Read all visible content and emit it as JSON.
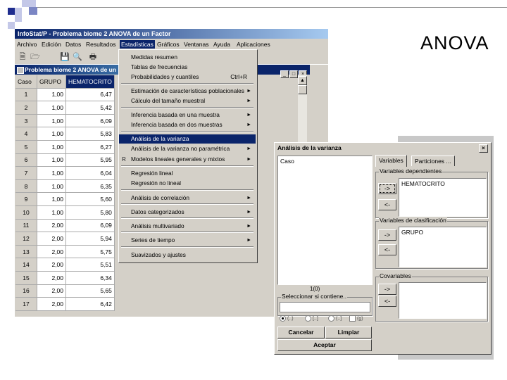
{
  "slide_title": "ANOVA",
  "app": {
    "title": "InfoStat/P - Problema biome 2 ANOVA de un Factor",
    "menus": [
      "Archivo",
      "Edición",
      "Datos",
      "Resultados",
      "Estadísticas",
      "Gráficos",
      "Ventanas",
      "Ayuda",
      "Aplicaciones"
    ]
  },
  "toolbar": {
    "icons": [
      "new-file-icon",
      "open-file-icon",
      "save-icon",
      "print-preview-icon",
      "print-icon"
    ]
  },
  "data_window": {
    "title": "Problema biome 2 ANOVA de un",
    "columns": [
      "Caso",
      "GRUPO",
      "HEMATOCRITO"
    ],
    "rows": [
      [
        "1",
        "1,00",
        "6,47"
      ],
      [
        "2",
        "1,00",
        "5,42"
      ],
      [
        "3",
        "1,00",
        "6,09"
      ],
      [
        "4",
        "1,00",
        "5,83"
      ],
      [
        "5",
        "1,00",
        "6,27"
      ],
      [
        "6",
        "1,00",
        "5,95"
      ],
      [
        "7",
        "1,00",
        "6,04"
      ],
      [
        "8",
        "1,00",
        "6,35"
      ],
      [
        "9",
        "1,00",
        "5,60"
      ],
      [
        "10",
        "1,00",
        "5,80"
      ],
      [
        "11",
        "2,00",
        "6,09"
      ],
      [
        "12",
        "2,00",
        "5,94"
      ],
      [
        "13",
        "2,00",
        "5,75"
      ],
      [
        "14",
        "2,00",
        "5,51"
      ],
      [
        "15",
        "2,00",
        "6,34"
      ],
      [
        "16",
        "2,00",
        "5,65"
      ],
      [
        "17",
        "2,00",
        "6,42"
      ]
    ]
  },
  "menu": {
    "items": [
      {
        "label": "Medidas resumen",
        "arrow": false
      },
      {
        "label": "Tablas de frecuencias",
        "arrow": false
      },
      {
        "label": "Probabilidades y cuantiles",
        "shortcut": "Ctrl+R"
      },
      {
        "label": "Estimación de características poblacionales",
        "arrow": true
      },
      {
        "label": "Cálculo del tamaño muestral",
        "arrow": true
      },
      {
        "label": "Inferencia basada en una muestra",
        "arrow": true
      },
      {
        "label": "Inferencia basada en dos muestras",
        "arrow": true
      },
      {
        "label": "Análisis de la varianza",
        "arrow": false,
        "highlighted": true
      },
      {
        "label": "Análisis de la varianza no paramétrica",
        "arrow": true
      },
      {
        "label": "Modelos lineales generales y mixtos",
        "arrow": true
      },
      {
        "label": "Regresión lineal",
        "arrow": false
      },
      {
        "label": "Regresión no lineal",
        "arrow": false
      },
      {
        "label": "Análisis de correlación",
        "arrow": true
      },
      {
        "label": "Datos categorizados",
        "arrow": true
      },
      {
        "label": "Análisis multivariado",
        "arrow": true
      },
      {
        "label": "Series de tiempo",
        "arrow": true
      },
      {
        "label": "Suavizados y ajustes",
        "arrow": false
      }
    ]
  },
  "dialog": {
    "title": "Análisis de la varianza",
    "source_list_item": "Caso",
    "count": "1(0)",
    "filter_label": "Seleccionar si contiene..",
    "radio_labels": [
      "(..)",
      "[..]",
      "(..]",
      "(g)"
    ],
    "tabs": [
      "Variables",
      "Particiones ..."
    ],
    "dependent_label": "Variables dependientes",
    "dependent_value": "HEMATOCRITO",
    "class_label": "Variables de clasificación",
    "class_value": "GRUPO",
    "covariables_label": "Covariables",
    "add_arrow": "->",
    "remove_arrow": "<-",
    "cancel_label": "Cancelar",
    "clear_label": "Limpiar",
    "accept_label": "Aceptar"
  },
  "colors": {
    "title_bar": "#0a246a",
    "menu_highlight": "#0a246a",
    "decor_blue": "#1f2d8f",
    "window_face": "#d4d0c8"
  }
}
